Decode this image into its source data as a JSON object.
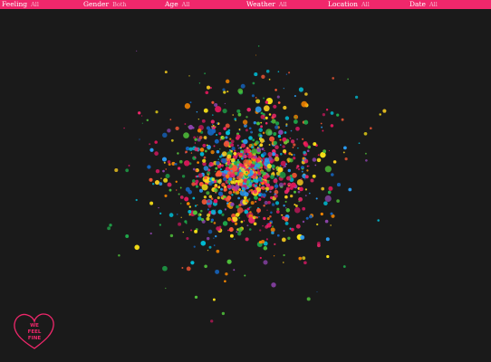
{
  "filters": [
    {
      "label": "Feeling",
      "value": "All"
    },
    {
      "label": "Gender",
      "value": "Both"
    },
    {
      "label": "Age",
      "value": "All"
    },
    {
      "label": "Weather",
      "value": "All"
    },
    {
      "label": "Location",
      "value": "All"
    },
    {
      "label": "Date",
      "value": "All"
    }
  ],
  "logo": {
    "line1": "WE",
    "line2": "FEEL",
    "line3": "FINE"
  },
  "colors": {
    "background": "#1a1a1a",
    "bar": "#f0276b",
    "particles": [
      "#f0276b",
      "#e8175d",
      "#ff8a00",
      "#ffd21f",
      "#f7e017",
      "#4fc13a",
      "#1fa84a",
      "#2a9df4",
      "#1565c0",
      "#8e44ad",
      "#c2185b",
      "#ff5a36",
      "#00bcd4"
    ]
  }
}
